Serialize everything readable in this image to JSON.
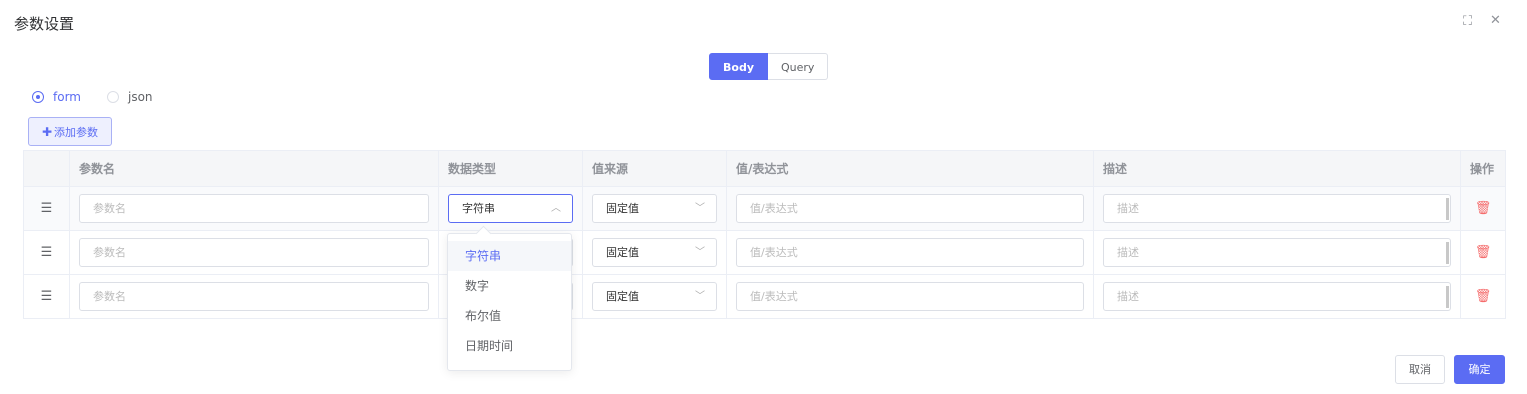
{
  "dialog": {
    "title": "参数设置"
  },
  "tabs": [
    {
      "label": "Body"
    },
    {
      "label": "Query"
    }
  ],
  "format": {
    "options": [
      {
        "label": "form"
      },
      {
        "label": "json"
      }
    ],
    "selected": "form"
  },
  "add_button": {
    "label": "添加参数"
  },
  "table": {
    "headers": {
      "name": "参数名",
      "type": "数据类型",
      "source": "值来源",
      "expr": "值/表达式",
      "desc": "描述",
      "action": "操作"
    },
    "rows": [
      {
        "name_placeholder": "参数名",
        "type": "字符串",
        "source": "固定值",
        "expr_placeholder": "值/表达式",
        "desc_placeholder": "描述"
      },
      {
        "name_placeholder": "参数名",
        "type": "",
        "source": "固定值",
        "expr_placeholder": "值/表达式",
        "desc_placeholder": "描述"
      },
      {
        "name_placeholder": "参数名",
        "type": "",
        "source": "固定值",
        "expr_placeholder": "值/表达式",
        "desc_placeholder": "描述"
      }
    ]
  },
  "type_dropdown": {
    "options": [
      "字符串",
      "数字",
      "布尔值",
      "日期时间"
    ],
    "selected": "字符串"
  },
  "footer": {
    "cancel": "取消",
    "ok": "确定"
  },
  "colors": {
    "accent": "#5b6cf3",
    "danger": "#f56c6c"
  }
}
